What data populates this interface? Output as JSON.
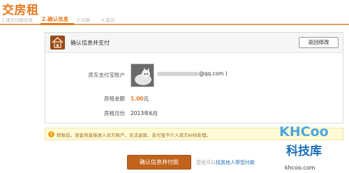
{
  "page": {
    "title": "交房租"
  },
  "steps": [
    {
      "label": "1.填写付款信息"
    },
    {
      "label": "2.确认信息"
    },
    {
      "label": "3.付款"
    },
    {
      "label": "4.成功"
    }
  ],
  "panel": {
    "header_text": "确认信息并支付",
    "back_button": "返回修改",
    "rows": {
      "account_label": "房东支付宝账户",
      "account_email": "@qq.com )",
      "amount_label": "房租金额",
      "amount_value": "1.00",
      "amount_unit": "元",
      "month_label": "房租月份",
      "month_value": "2013年6月"
    }
  },
  "notice": {
    "text": "转账后，资金将直接进入对方账户，无法退款，支付宝不介入双方纠纷处理。"
  },
  "actions": {
    "pay_button": "确认信息并付款",
    "alt_prefix": "您也可以",
    "alt_link": "找其他人帮您付款"
  },
  "watermark": {
    "logo": "KHCoo",
    "name": "科技库",
    "url": "khcoo.com"
  },
  "colors": {
    "accent": "#e87a1e",
    "button": "#c2631c",
    "link": "#1f6fb5",
    "notice_bg": "#fffbd6"
  }
}
